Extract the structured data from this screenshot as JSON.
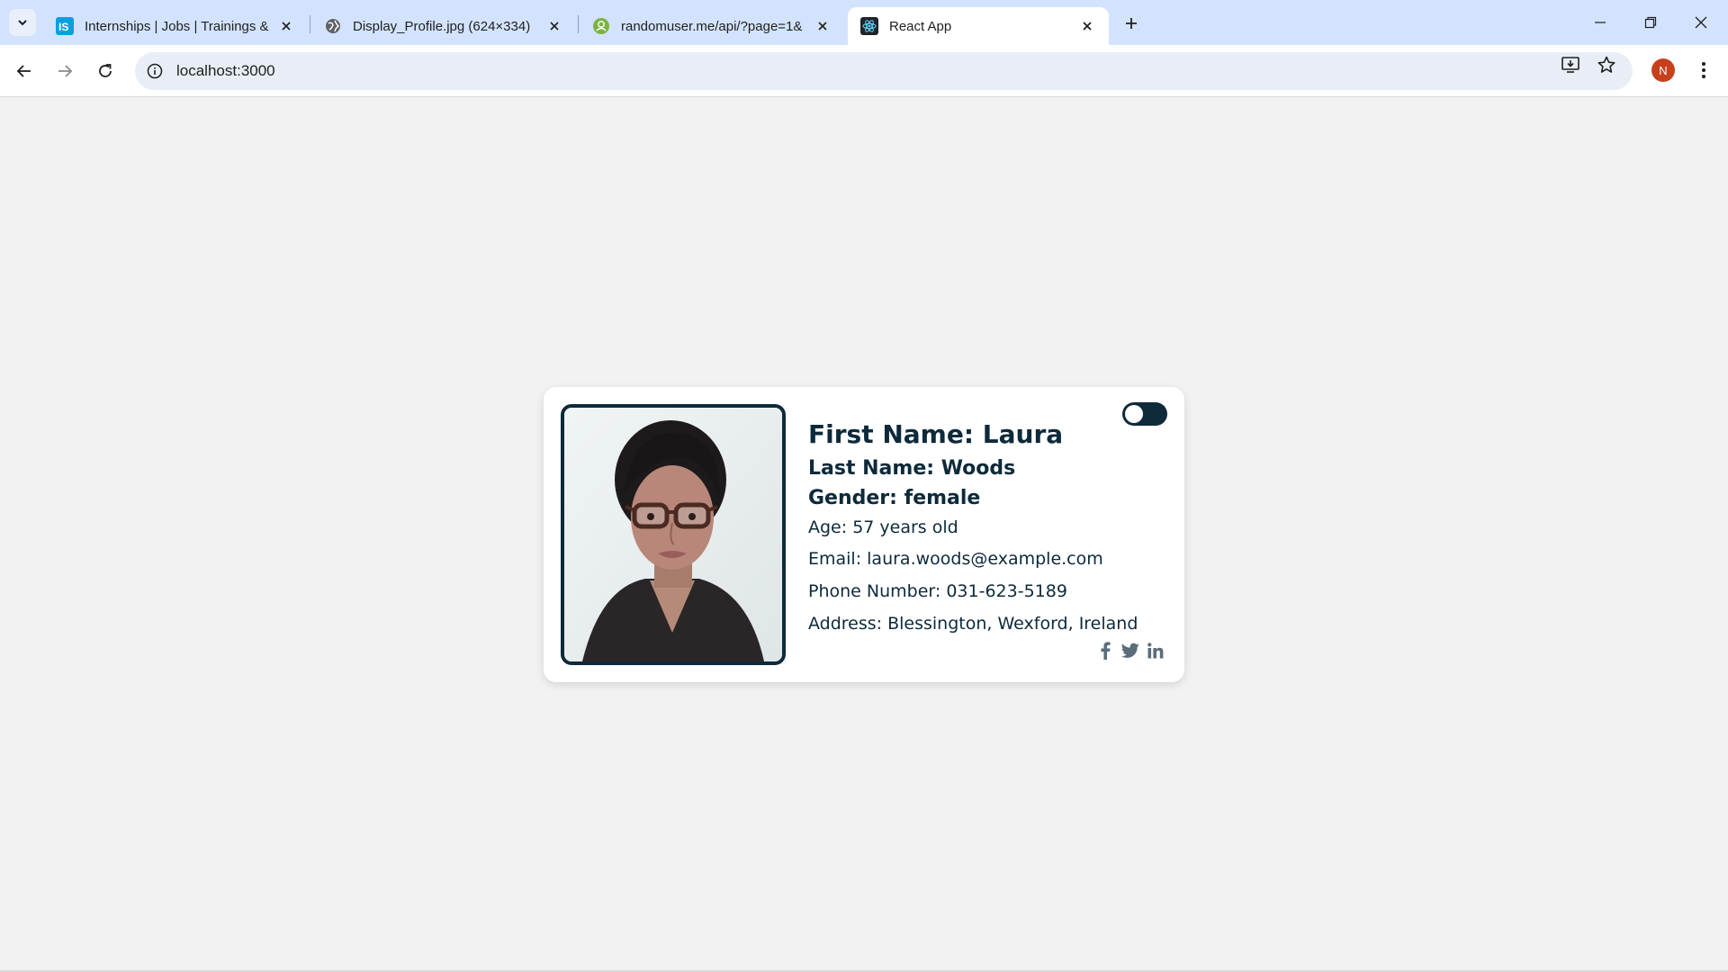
{
  "browser": {
    "tabs": [
      {
        "title": "Internships | Jobs | Trainings & I",
        "favicon": "internshala-favicon",
        "active": false
      },
      {
        "title": "Display_Profile.jpg (624×334)",
        "favicon": "globe-icon",
        "active": false
      },
      {
        "title": "randomuser.me/api/?page=1&",
        "favicon": "randomuser-favicon",
        "active": false
      },
      {
        "title": "React App",
        "favicon": "react-icon",
        "active": true
      }
    ],
    "url": "localhost:3000",
    "profile_initial": "N"
  },
  "profile": {
    "first_name": "First Name: Laura",
    "last_name": "Last Name: Woods",
    "gender": "Gender: female",
    "age": "Age: 57 years old",
    "email": "Email: laura.woods@example.com",
    "phone": "Phone Number: 031-623-5189",
    "address": "Address: Blessington, Wexford, Ireland",
    "theme_toggle_on": false,
    "social_icons": [
      "facebook-icon",
      "twitter-icon",
      "linkedin-icon"
    ]
  },
  "colors": {
    "card_text": "#0d2a3a",
    "page_bg": "#f2f2f2",
    "tabbar_bg": "#d3e3fd",
    "accent_navy": "#0e2a3b"
  }
}
